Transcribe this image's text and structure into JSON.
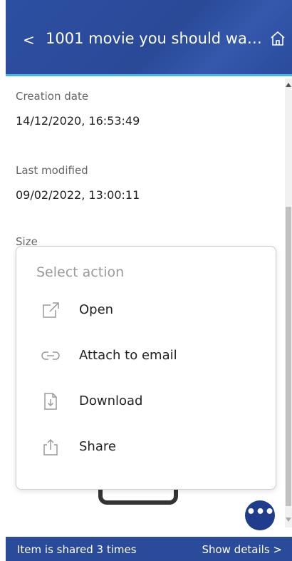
{
  "header": {
    "back_icon": "chevron-left-icon",
    "title": "1001 movie you should watc...",
    "home_icon": "home-icon"
  },
  "details": {
    "creation_label": "Creation date",
    "creation_value": "14/12/2020, 16:53:49",
    "modified_label": "Last modified",
    "modified_value": "09/02/2022, 13:00:11",
    "size_label": "Size"
  },
  "action_panel": {
    "heading": "Select action",
    "actions": [
      {
        "label": "Open",
        "icon": "external-link-icon"
      },
      {
        "label": "Attach to email",
        "icon": "link-icon"
      },
      {
        "label": "Download",
        "icon": "download-icon"
      },
      {
        "label": "Share",
        "icon": "share-icon"
      }
    ]
  },
  "fab": {
    "label": "•••",
    "icon": "more-icon"
  },
  "footer": {
    "shared_text": "Item is shared 3 times",
    "details_link": "Show details >"
  },
  "colors": {
    "primary": "#2a4a9a",
    "accent": "#3fb7e8"
  }
}
